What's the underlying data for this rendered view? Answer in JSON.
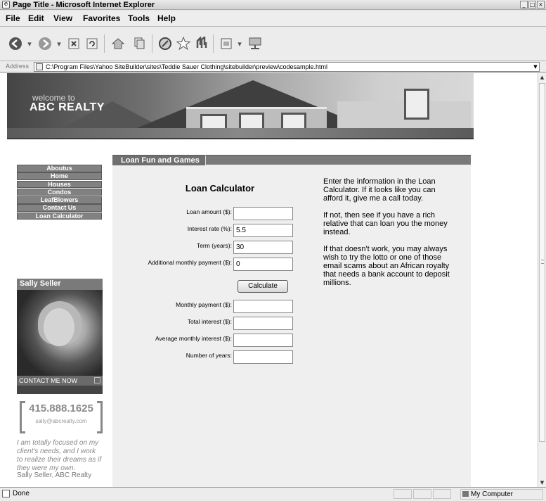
{
  "window": {
    "title": "Page Title - Microsoft Internet Explorer"
  },
  "menu": [
    "File",
    "Edit",
    "View",
    "Favorites",
    "Tools",
    "Help"
  ],
  "address": {
    "label": "Address",
    "url": "C:\\Program Files\\Yahoo SiteBuilder\\sites\\Teddie Sauer Clothing\\sitebuilder\\preview\\codesample.html"
  },
  "page": {
    "banner": {
      "welcome": "welcome to",
      "brand": "ABC REALTY"
    },
    "nav": [
      "Aboutus",
      "Home",
      "Houses",
      "Condos",
      "LeafBlowers",
      "Contact Us",
      "Loan Calculator"
    ],
    "profile": {
      "name": "Sally Seller",
      "contact": "CONTACT ME NOW"
    },
    "phone": "415.888.1625",
    "email": "sally@abcrealty.com",
    "quote": "I am totally focused on my client's needs, and I work to realize their dreams as if they were my own.",
    "signature": "Sally Seller, ABC Realty",
    "section_title": "Loan Fun and Games",
    "calculator": {
      "title": "Loan Calculator",
      "fields": [
        {
          "label": "Loan amount ($):",
          "value": ""
        },
        {
          "label": "Interest rate (%):",
          "value": "5.5"
        },
        {
          "label": "Term (years):",
          "value": "30"
        },
        {
          "label": "Additional monthly payment ($):",
          "value": "0"
        }
      ],
      "button": "Calculate",
      "outputs": [
        {
          "label": "Monthly payment ($):",
          "value": ""
        },
        {
          "label": "Total interest ($):",
          "value": ""
        },
        {
          "label": "Average monthly interest ($):",
          "value": ""
        },
        {
          "label": "Number of years:",
          "value": ""
        }
      ]
    },
    "info": [
      "Enter the information in the Loan Calculator. If it looks like you can afford it, give me a call today.",
      "If not, then see if you have a rich relative that can loan you the money instead.",
      "If that doesn't work, you may always wish to try the lotto or one of those email scams about an African royalty that needs a bank account to deposit millions."
    ]
  },
  "status": {
    "text": "Done",
    "zone": "My Computer"
  }
}
